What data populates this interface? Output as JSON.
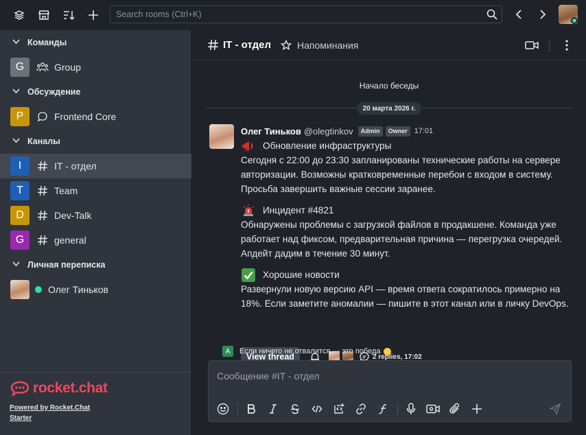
{
  "topbar": {
    "search_placeholder": "Search rooms (Ctrl+K)",
    "icons": [
      "layers-icon",
      "directory-icon",
      "sort-icon",
      "create-new-icon",
      "search-icon",
      "back-icon",
      "forward-icon"
    ]
  },
  "sidebar": {
    "groups": [
      {
        "title": "Команды",
        "rooms": [
          {
            "letter": "G",
            "name": "Group",
            "color": "#6c727a",
            "icon": "team-icon"
          }
        ]
      },
      {
        "title": "Обсуждение",
        "rooms": [
          {
            "letter": "P",
            "name": "Frontend Core",
            "color": "#c79606",
            "icon": "discussion-icon"
          }
        ]
      },
      {
        "title": "Каналы",
        "rooms": [
          {
            "letter": "I",
            "name": "IT - отдел",
            "color": "#1d5fb4",
            "icon": "hashtag-icon",
            "active": true
          },
          {
            "letter": "T",
            "name": "Team",
            "color": "#1d5fb4",
            "icon": "hashtag-icon"
          },
          {
            "letter": "D",
            "name": "Dev-Talk",
            "color": "#c79606",
            "icon": "hashtag-icon"
          },
          {
            "letter": "G",
            "name": "general",
            "color": "#9c27b0",
            "icon": "hashtag-icon"
          }
        ]
      },
      {
        "title": "Личная переписка",
        "rooms": [
          {
            "name": "Олег Тиньков",
            "status": "online"
          }
        ]
      }
    ],
    "footer": {
      "logo_text": "rocket.chat",
      "powered_by": "Powered by Rocket.Chat",
      "plan": "Starter"
    }
  },
  "room": {
    "title": "IT - отдел",
    "topic": "Напоминания",
    "conversation_start": "Начало беседы",
    "date_divider": "20 марта 2026 г."
  },
  "message": {
    "author_name": "Олег Тиньков",
    "username": "@olegtinkov",
    "roles": [
      "Admin",
      "Owner"
    ],
    "time": "17:01",
    "sections": [
      {
        "emoji": "megaphone-icon",
        "title": "Обновление инфраструктуры",
        "text": "Сегодня с 22:00 до 23:30 запланированы технические работы на сервере авторизации. Возможны кратковременные перебои с входом в систему. Просьба завершить важные сессии заранее."
      },
      {
        "emoji": "siren-icon",
        "title": "Инцидент #4821",
        "text": "Обнаружены проблемы с загрузкой файлов в продакшене. Команда уже работает над фиксом, предварительная причина — перегрузка очередей. Апдейт дадим в течение 30 минут."
      },
      {
        "emoji": "check-mark-icon",
        "title": "Хорошие новости",
        "text": "Развернули новую версию API — время ответа сократилось примерно на 18%. Если заметите аномалии — пишите в этот канал или в личку DevOps."
      }
    ],
    "view_thread": "View thread",
    "replies": "2 replies, 17:02"
  },
  "thread_preview": {
    "avatar_letter": "A",
    "text": "Если ничего не отвалится — это победа"
  },
  "composer": {
    "placeholder": "Сообщение #IT - отдел"
  },
  "colors": {
    "accent_online": "#2de0a5",
    "brand_red": "#f5455c"
  }
}
